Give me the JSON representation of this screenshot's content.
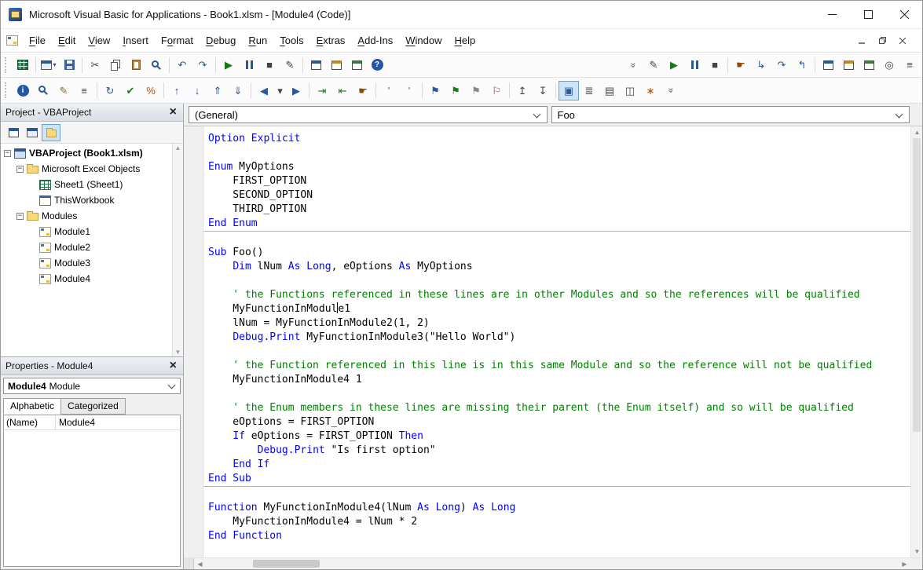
{
  "colors": {
    "keyword": "#0000ff",
    "comment": "#008000",
    "text": "#000000",
    "accent": "#2b5797",
    "run_green": "#107c10"
  },
  "titlebar": {
    "title": "Microsoft Visual Basic for Applications - Book1.xlsm - [Module4 (Code)]"
  },
  "menubar": {
    "items": [
      {
        "label": "File",
        "accel": 0
      },
      {
        "label": "Edit",
        "accel": 0
      },
      {
        "label": "View",
        "accel": 0
      },
      {
        "label": "Insert",
        "accel": 0
      },
      {
        "label": "Format",
        "accel": 1
      },
      {
        "label": "Debug",
        "accel": 0
      },
      {
        "label": "Run",
        "accel": 0
      },
      {
        "label": "Tools",
        "accel": 0
      },
      {
        "label": "Extras",
        "accel": 0
      },
      {
        "label": "Add-Ins",
        "accel": 0
      },
      {
        "label": "Window",
        "accel": 0
      },
      {
        "label": "Help",
        "accel": 0
      }
    ]
  },
  "toolbars": {
    "row1": {
      "items": [
        {
          "name": "view-microsoft-excel",
          "icon": "excel"
        },
        {
          "sep": true
        },
        {
          "name": "insert-userform",
          "icon": "form",
          "dropdown": true
        },
        {
          "name": "save",
          "icon": "save"
        },
        {
          "sep": true
        },
        {
          "name": "cut",
          "glyph": "✂",
          "color": "#444444"
        },
        {
          "name": "copy",
          "icon": "copy"
        },
        {
          "name": "paste",
          "icon": "paste"
        },
        {
          "name": "find",
          "icon": "mag"
        },
        {
          "sep": true
        },
        {
          "name": "undo",
          "glyph": "↶",
          "color": "#2b5797"
        },
        {
          "name": "redo",
          "glyph": "↷",
          "color": "#2b5797"
        },
        {
          "sep": true
        },
        {
          "name": "run-sub",
          "glyph": "▶",
          "color": "#107c10"
        },
        {
          "name": "break",
          "icon": "pause"
        },
        {
          "name": "reset",
          "glyph": "■",
          "color": "#444444"
        },
        {
          "name": "design-mode",
          "glyph": "✎",
          "color": "#444444"
        },
        {
          "sep": true
        },
        {
          "name": "project-explorer",
          "icon": "win1"
        },
        {
          "name": "properties-window",
          "icon": "win2"
        },
        {
          "name": "object-browser",
          "icon": "win3"
        },
        {
          "name": "help",
          "icon": "help"
        },
        {
          "flex": true
        },
        {
          "name": "toolbar-overflow",
          "overflow": true
        },
        {
          "name": "design-mode-debug",
          "glyph": "✎",
          "color": "#444444"
        },
        {
          "name": "run-debug",
          "glyph": "▶",
          "color": "#107c10"
        },
        {
          "name": "break-debug",
          "icon": "pause"
        },
        {
          "name": "reset-debug",
          "glyph": "■",
          "color": "#444444"
        },
        {
          "sep": true
        },
        {
          "name": "toggle-breakpoint",
          "glyph": "☛",
          "color": "#8a4a00"
        },
        {
          "name": "step-into",
          "glyph": "↳",
          "color": "#2b5797"
        },
        {
          "name": "step-over",
          "glyph": "↷",
          "color": "#2b5797"
        },
        {
          "name": "step-out",
          "glyph": "↰",
          "color": "#2b5797"
        },
        {
          "sep": true
        },
        {
          "name": "locals-window",
          "icon": "win1"
        },
        {
          "name": "immediate-window",
          "icon": "win2"
        },
        {
          "name": "watch-window",
          "icon": "win3"
        },
        {
          "name": "quick-watch",
          "glyph": "◎",
          "color": "#444444"
        },
        {
          "name": "call-stack",
          "glyph": "≡",
          "color": "#444444"
        }
      ]
    },
    "row2": {
      "items": [
        {
          "name": "quick-info",
          "icon": "info"
        },
        {
          "name": "find-symbol",
          "icon": "mag"
        },
        {
          "name": "edit-code",
          "glyph": "✎",
          "color": "#8a6d1a"
        },
        {
          "name": "list-members",
          "glyph": "≡",
          "color": "#444444"
        },
        {
          "sep": true
        },
        {
          "name": "refresh",
          "glyph": "↻",
          "color": "#2b5797"
        },
        {
          "name": "compile",
          "glyph": "✔",
          "color": "#1a7a1a"
        },
        {
          "name": "format-code",
          "glyph": "%",
          "color": "#b34d00"
        },
        {
          "sep": true
        },
        {
          "name": "previous-procedure",
          "glyph": "↑",
          "color": "#2b5797"
        },
        {
          "name": "next-procedure",
          "glyph": "↓",
          "color": "#2b5797"
        },
        {
          "name": "module-top",
          "glyph": "⇑",
          "color": "#2b5797"
        },
        {
          "name": "module-bottom",
          "glyph": "⇓",
          "color": "#2b5797"
        },
        {
          "sep": true
        },
        {
          "name": "navigate-back",
          "glyph": "◀",
          "color": "#2b5797"
        },
        {
          "name": "navigate-dropdown",
          "glyph": "▾",
          "color": "#444444",
          "narrow": true
        },
        {
          "name": "navigate-forward",
          "glyph": "▶",
          "color": "#2b5797"
        },
        {
          "sep": true
        },
        {
          "name": "indent",
          "glyph": "⇥",
          "color": "#1a7a1a"
        },
        {
          "name": "outdent",
          "glyph": "⇤",
          "color": "#1a7a1a"
        },
        {
          "name": "toggle-breakpoint-edit",
          "glyph": "☛",
          "color": "#8a4a00"
        },
        {
          "sep": true
        },
        {
          "name": "comment-block",
          "glyph": "'",
          "color": "#1a7a1a"
        },
        {
          "name": "uncomment-block",
          "glyph": "'",
          "color": "#b33636"
        },
        {
          "sep": true
        },
        {
          "name": "toggle-bookmark",
          "glyph": "⚑",
          "color": "#2b5797"
        },
        {
          "name": "next-bookmark",
          "glyph": "⚑",
          "color": "#1a7a1a"
        },
        {
          "name": "previous-bookmark",
          "glyph": "⚑",
          "color": "#888888"
        },
        {
          "name": "clear-bookmarks",
          "glyph": "⚐",
          "color": "#b33636"
        },
        {
          "sep": true
        },
        {
          "name": "export-module",
          "glyph": "↥",
          "color": "#444444"
        },
        {
          "name": "import-module",
          "glyph": "↧",
          "color": "#444444"
        },
        {
          "sep": true
        },
        {
          "name": "find-all-references",
          "glyph": "▣",
          "color": "#2b5797",
          "active": true
        },
        {
          "name": "call-tree",
          "glyph": "≣",
          "color": "#444444"
        },
        {
          "name": "todo-list",
          "glyph": "▤",
          "color": "#444444"
        },
        {
          "name": "code-pane",
          "glyph": "◫",
          "color": "#444444"
        },
        {
          "name": "options",
          "glyph": "∗",
          "color": "#b34d00"
        },
        {
          "name": "toolbar-overflow-2",
          "overflow": true
        }
      ]
    }
  },
  "project_panel": {
    "title": "Project - VBAProject",
    "buttons": [
      {
        "name": "view-code",
        "icon": "win1"
      },
      {
        "name": "view-object",
        "icon": "form"
      },
      {
        "name": "toggle-folders",
        "icon": "folder",
        "active": true
      }
    ],
    "tree": [
      {
        "level": 0,
        "expander": "-",
        "icon": "project",
        "label": "VBAProject (Book1.xlsm)",
        "bold": true
      },
      {
        "level": 1,
        "expander": "-",
        "icon": "folder",
        "label": "Microsoft Excel Objects"
      },
      {
        "level": 2,
        "expander": "",
        "icon": "sheet",
        "label": "Sheet1 (Sheet1)"
      },
      {
        "level": 2,
        "expander": "",
        "icon": "workbook",
        "label": "ThisWorkbook"
      },
      {
        "level": 1,
        "expander": "-",
        "icon": "folder",
        "label": "Modules"
      },
      {
        "level": 2,
        "expander": "",
        "icon": "module",
        "label": "Module1"
      },
      {
        "level": 2,
        "expander": "",
        "icon": "module",
        "label": "Module2"
      },
      {
        "level": 2,
        "expander": "",
        "icon": "module",
        "label": "Module3"
      },
      {
        "level": 2,
        "expander": "",
        "icon": "module",
        "label": "Module4"
      }
    ]
  },
  "properties_panel": {
    "title": "Properties - Module4",
    "object_name": "Module4",
    "object_type": "Module",
    "tabs": [
      {
        "label": "Alphabetic",
        "active": true
      },
      {
        "label": "Categorized",
        "active": false
      }
    ],
    "rows": [
      {
        "name": "(Name)",
        "value": "Module4"
      }
    ]
  },
  "code_window": {
    "object_combo": "(General)",
    "procedure_combo": "Foo",
    "lines": [
      {
        "seg": [
          [
            "k",
            "Option Explicit"
          ]
        ]
      },
      {
        "seg": []
      },
      {
        "seg": [
          [
            "k",
            "Enum"
          ],
          [
            "t",
            " MyOptions"
          ]
        ]
      },
      {
        "seg": [
          [
            "t",
            "    FIRST_OPTION"
          ]
        ]
      },
      {
        "seg": [
          [
            "t",
            "    SECOND_OPTION"
          ]
        ]
      },
      {
        "seg": [
          [
            "t",
            "    THIRD_OPTION"
          ]
        ]
      },
      {
        "seg": [
          [
            "k",
            "End Enum"
          ]
        ]
      },
      {
        "sep": true
      },
      {
        "seg": []
      },
      {
        "seg": [
          [
            "k",
            "Sub"
          ],
          [
            "t",
            " Foo()"
          ]
        ]
      },
      {
        "seg": [
          [
            "t",
            "    "
          ],
          [
            "k",
            "Dim"
          ],
          [
            "t",
            " lNum "
          ],
          [
            "k",
            "As"
          ],
          [
            "t",
            " "
          ],
          [
            "k",
            "Long"
          ],
          [
            "t",
            ", eOptions "
          ],
          [
            "k",
            "As"
          ],
          [
            "t",
            " MyOptions"
          ]
        ]
      },
      {
        "seg": []
      },
      {
        "seg": [
          [
            "c",
            "    ' the Functions referenced in these lines are in other Modules and so the references will be qualified"
          ]
        ]
      },
      {
        "seg": [
          [
            "t",
            "    MyFunctionInModul"
          ],
          [
            "caret",
            ""
          ],
          [
            "t",
            "e1"
          ]
        ]
      },
      {
        "seg": [
          [
            "t",
            "    lNum = MyFunctionInModule2(1, 2)"
          ]
        ]
      },
      {
        "seg": [
          [
            "t",
            "    "
          ],
          [
            "k",
            "Debug.Print"
          ],
          [
            "t",
            " MyFunctionInModule3(\"Hello World\")"
          ]
        ]
      },
      {
        "seg": []
      },
      {
        "seg": [
          [
            "c",
            "    ' the Function referenced in this line is in this same Module and so the reference will not be qualified"
          ]
        ]
      },
      {
        "seg": [
          [
            "t",
            "    MyFunctionInModule4 1"
          ]
        ]
      },
      {
        "seg": []
      },
      {
        "seg": [
          [
            "c",
            "    ' the Enum members in these lines are missing their parent (the Enum itself) and so will be qualified"
          ]
        ]
      },
      {
        "seg": [
          [
            "t",
            "    eOptions = FIRST_OPTION"
          ]
        ]
      },
      {
        "seg": [
          [
            "t",
            "    "
          ],
          [
            "k",
            "If"
          ],
          [
            "t",
            " eOptions = FIRST_OPTION "
          ],
          [
            "k",
            "Then"
          ]
        ]
      },
      {
        "seg": [
          [
            "t",
            "        "
          ],
          [
            "k",
            "Debug.Print"
          ],
          [
            "t",
            " \"Is first option\""
          ]
        ]
      },
      {
        "seg": [
          [
            "t",
            "    "
          ],
          [
            "k",
            "End If"
          ]
        ]
      },
      {
        "seg": [
          [
            "k",
            "End Sub"
          ]
        ]
      },
      {
        "sep": true
      },
      {
        "seg": []
      },
      {
        "seg": [
          [
            "k",
            "Function"
          ],
          [
            "t",
            " MyFunctionInModule4(lNum "
          ],
          [
            "k",
            "As"
          ],
          [
            "t",
            " "
          ],
          [
            "k",
            "Long"
          ],
          [
            "t",
            ") "
          ],
          [
            "k",
            "As"
          ],
          [
            "t",
            " "
          ],
          [
            "k",
            "Long"
          ]
        ]
      },
      {
        "seg": [
          [
            "t",
            "    MyFunctionInModule4 = lNum * 2"
          ]
        ]
      },
      {
        "seg": [
          [
            "k",
            "End Function"
          ]
        ]
      }
    ]
  }
}
